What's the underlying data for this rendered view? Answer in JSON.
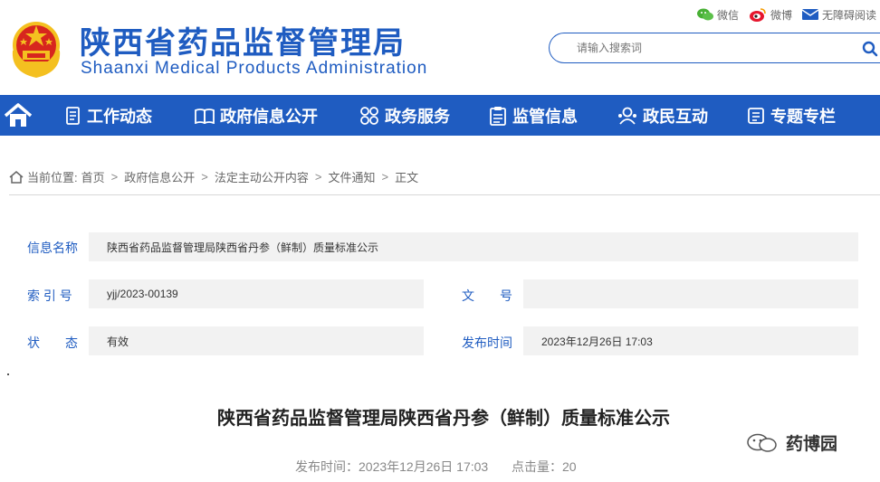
{
  "header": {
    "title_cn": "陕西省药品监督管理局",
    "title_en": "Shaanxi Medical Products Administration",
    "links": [
      {
        "label": "微信",
        "icon": "wechat-icon"
      },
      {
        "label": "微博",
        "icon": "weibo-icon"
      },
      {
        "label": "无障碍阅读",
        "icon": "accessibility-mail-icon"
      }
    ],
    "search": {
      "placeholder": "请输入搜索词",
      "icon": "search-icon"
    }
  },
  "nav": {
    "home_icon": "home-icon",
    "items": [
      {
        "label": "工作动态",
        "icon": "document-icon"
      },
      {
        "label": "政府信息公开",
        "icon": "book-icon"
      },
      {
        "label": "政务服务",
        "icon": "grid-icon"
      },
      {
        "label": "监管信息",
        "icon": "clipboard-icon"
      },
      {
        "label": "政民互动",
        "icon": "people-icon"
      },
      {
        "label": "专题专栏",
        "icon": "folder-icon"
      }
    ]
  },
  "breadcrumb": {
    "prefix": "当前位置:",
    "items": [
      "首页",
      "政府信息公开",
      "法定主动公开内容",
      "文件通知",
      "正文"
    ]
  },
  "info": {
    "name_label": "信息名称",
    "name_value": "陕西省药品监督管理局陕西省丹参（鲜制）质量标准公示",
    "index_label": "索 引 号",
    "index_value": "yjj/2023-00139",
    "doc_label": "文　　号",
    "doc_value": "",
    "status_label": "状　　态",
    "status_value": "有效",
    "date_label": "发布时间",
    "date_value": "2023年12月26日 17:03"
  },
  "article": {
    "title": "陕西省药品监督管理局陕西省丹参（鲜制）质量标准公示",
    "publish_label": "发布时间：",
    "publish_time": "2023年12月26日 17:03",
    "views_label": "点击量：",
    "views": "20"
  },
  "watermark": {
    "text": "药博园"
  },
  "colors": {
    "brand_blue": "#1f5cc1",
    "emblem_red": "#d7261e",
    "emblem_gold": "#f4c020"
  }
}
